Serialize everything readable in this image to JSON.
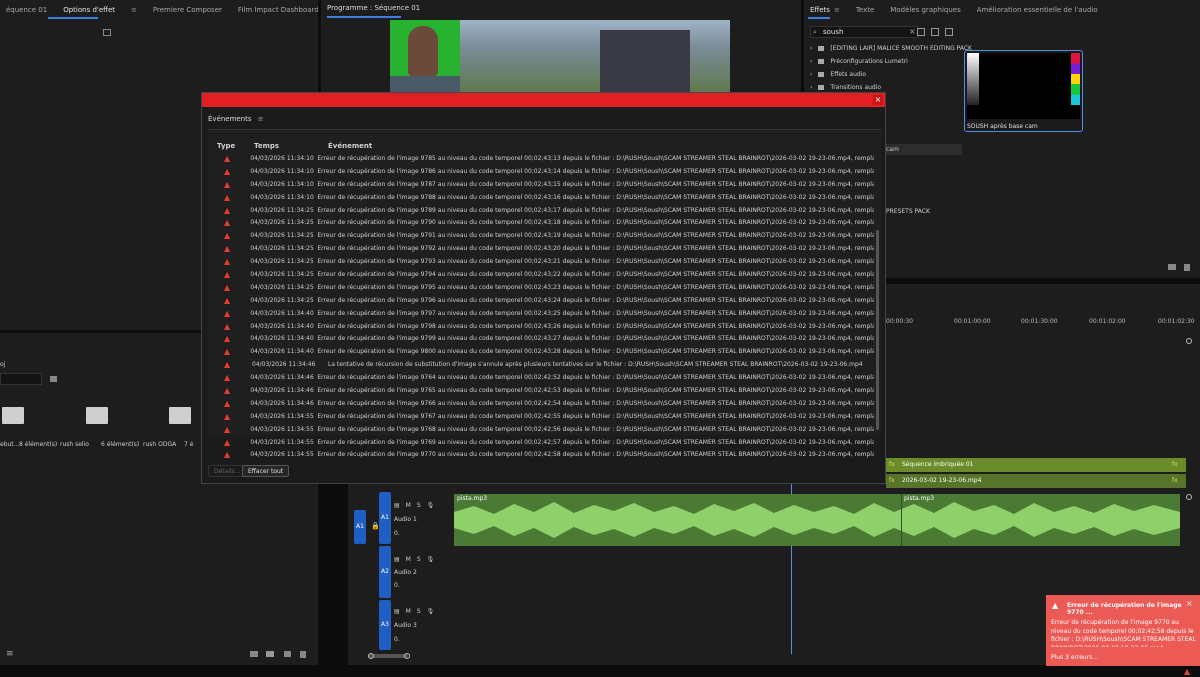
{
  "left_panel": {
    "tabs": [
      {
        "label": "équence 01"
      },
      {
        "label": "Options d'effet"
      },
      {
        "label": "Premiere Composer"
      },
      {
        "label": "Film Impact Dashboard"
      }
    ],
    "project_label": "oj",
    "bins": [
      {
        "name": "ebut...",
        "count": "8 élément(s)"
      },
      {
        "name": "rush selio",
        "count": "6 élément(s)"
      },
      {
        "name": "rush ODGA",
        "count": "7 é"
      }
    ]
  },
  "program_monitor": {
    "title": "Programme : Séquence 01"
  },
  "effects_panel": {
    "tabs": [
      {
        "label": "Effets"
      },
      {
        "label": "Texte"
      },
      {
        "label": "Modèles graphiques"
      },
      {
        "label": "Amélioration essentielle de l'audio"
      }
    ],
    "search_value": "soush",
    "tree": [
      {
        "label": "[EDITING LAIR] MALICE SMOOTH EDITING PACK"
      },
      {
        "label": "Préconfigurations Lumetri"
      },
      {
        "label": "Effets audio"
      },
      {
        "label": "Transitions audio"
      }
    ],
    "partial_labels": [
      "cam",
      "PRESETS PACK"
    ],
    "preview_caption": "SOUSH après base cam"
  },
  "events_dialog": {
    "title": "Événements",
    "columns": {
      "type": "Type",
      "time": "Temps",
      "event": "Événement"
    },
    "rows": [
      {
        "time": "04/03/2026 11:34:10",
        "msg": "Erreur de récupération de l'image 9785 au niveau du code temporel 00;02;43;13 depuis le fichier : D:\\RUSH\\Soush\\SCAM STREAMER STEAL BRAINROT\\2026-03-02 19-23-06.mp4, remplacement de l'image 9784"
      },
      {
        "time": "04/03/2026 11:34:10",
        "msg": "Erreur de récupération de l'image 9786 au niveau du code temporel 00;02;43;14 depuis le fichier : D:\\RUSH\\Soush\\SCAM STREAMER STEAL BRAINROT\\2026-03-02 19-23-06.mp4, remplacement de l'image 9785"
      },
      {
        "time": "04/03/2026 11:34:10",
        "msg": "Erreur de récupération de l'image 9787 au niveau du code temporel 00;02;43;15 depuis le fichier : D:\\RUSH\\Soush\\SCAM STREAMER STEAL BRAINROT\\2026-03-02 19-23-06.mp4, remplacement de l'image 9786"
      },
      {
        "time": "04/03/2026 11:34:10",
        "msg": "Erreur de récupération de l'image 9788 au niveau du code temporel 00;02;43;16 depuis le fichier : D:\\RUSH\\Soush\\SCAM STREAMER STEAL BRAINROT\\2026-03-02 19-23-06.mp4, remplacement de l'image 9787"
      },
      {
        "time": "04/03/2026 11:34:25",
        "msg": "Erreur de récupération de l'image 9789 au niveau du code temporel 00;02;43;17 depuis le fichier : D:\\RUSH\\Soush\\SCAM STREAMER STEAL BRAINROT\\2026-03-02 19-23-06.mp4, remplacement de l'image 9788"
      },
      {
        "time": "04/03/2026 11:34:25",
        "msg": "Erreur de récupération de l'image 9790 au niveau du code temporel 00;02;43;18 depuis le fichier : D:\\RUSH\\Soush\\SCAM STREAMER STEAL BRAINROT\\2026-03-02 19-23-06.mp4, remplacement de l'image 9789"
      },
      {
        "time": "04/03/2026 11:34:25",
        "msg": "Erreur de récupération de l'image 9791 au niveau du code temporel 00;02;43;19 depuis le fichier : D:\\RUSH\\Soush\\SCAM STREAMER STEAL BRAINROT\\2026-03-02 19-23-06.mp4, remplacement de l'image 9790"
      },
      {
        "time": "04/03/2026 11:34:25",
        "msg": "Erreur de récupération de l'image 9792 au niveau du code temporel 00;02;43;20 depuis le fichier : D:\\RUSH\\Soush\\SCAM STREAMER STEAL BRAINROT\\2026-03-02 19-23-06.mp4, remplacement de l'image 9791"
      },
      {
        "time": "04/03/2026 11:34:25",
        "msg": "Erreur de récupération de l'image 9793 au niveau du code temporel 00;02;43;21 depuis le fichier : D:\\RUSH\\Soush\\SCAM STREAMER STEAL BRAINROT\\2026-03-02 19-23-06.mp4, remplacement de l'image 9792"
      },
      {
        "time": "04/03/2026 11:34:25",
        "msg": "Erreur de récupération de l'image 9794 au niveau du code temporel 00;02;43;22 depuis le fichier : D:\\RUSH\\Soush\\SCAM STREAMER STEAL BRAINROT\\2026-03-02 19-23-06.mp4, remplacement de l'image 9793"
      },
      {
        "time": "04/03/2026 11:34:25",
        "msg": "Erreur de récupération de l'image 9795 au niveau du code temporel 00;02;43;23 depuis le fichier : D:\\RUSH\\Soush\\SCAM STREAMER STEAL BRAINROT\\2026-03-02 19-23-06.mp4, remplacement de l'image 9794"
      },
      {
        "time": "04/03/2026 11:34:25",
        "msg": "Erreur de récupération de l'image 9796 au niveau du code temporel 00;02;43;24 depuis le fichier : D:\\RUSH\\Soush\\SCAM STREAMER STEAL BRAINROT\\2026-03-02 19-23-06.mp4, remplacement de l'image 9795"
      },
      {
        "time": "04/03/2026 11:34:40",
        "msg": "Erreur de récupération de l'image 9797 au niveau du code temporel 00;02;43;25 depuis le fichier : D:\\RUSH\\Soush\\SCAM STREAMER STEAL BRAINROT\\2026-03-02 19-23-06.mp4, remplacement de l'image 9796"
      },
      {
        "time": "04/03/2026 11:34:40",
        "msg": "Erreur de récupération de l'image 9798 au niveau du code temporel 00;02;43;26 depuis le fichier : D:\\RUSH\\Soush\\SCAM STREAMER STEAL BRAINROT\\2026-03-02 19-23-06.mp4, remplacement de l'image 9797"
      },
      {
        "time": "04/03/2026 11:34:40",
        "msg": "Erreur de récupération de l'image 9799 au niveau du code temporel 00;02;43;27 depuis le fichier : D:\\RUSH\\Soush\\SCAM STREAMER STEAL BRAINROT\\2026-03-02 19-23-06.mp4, remplacement de l'image 9798"
      },
      {
        "time": "04/03/2026 11:34:40",
        "msg": "Erreur de récupération de l'image 9800 au niveau du code temporel 00;02;43;28 depuis le fichier : D:\\RUSH\\Soush\\SCAM STREAMER STEAL BRAINROT\\2026-03-02 19-23-06.mp4, remplacement de l'image 9799"
      },
      {
        "time": "04/03/2026 11:34:46",
        "msg": "La tentative de récursion de substitution d'image s'annule après plusieurs tentatives sur le fichier : D:\\RUSH\\Soush\\SCAM STREAMER STEAL BRAINROT\\2026-03-02 19-23-06.mp4"
      },
      {
        "time": "04/03/2026 11:34:46",
        "msg": "Erreur de récupération de l'image 9764 au niveau du code temporel 00;02;42;52 depuis le fichier : D:\\RUSH\\Soush\\SCAM STREAMER STEAL BRAINROT\\2026-03-02 19-23-06.mp4, remplacement de l'image 9763"
      },
      {
        "time": "04/03/2026 11:34:46",
        "msg": "Erreur de récupération de l'image 9765 au niveau du code temporel 00;02;42;53 depuis le fichier : D:\\RUSH\\Soush\\SCAM STREAMER STEAL BRAINROT\\2026-03-02 19-23-06.mp4, remplacement de l'image 9764"
      },
      {
        "time": "04/03/2026 11:34:46",
        "msg": "Erreur de récupération de l'image 9766 au niveau du code temporel 00;02;42;54 depuis le fichier : D:\\RUSH\\Soush\\SCAM STREAMER STEAL BRAINROT\\2026-03-02 19-23-06.mp4, remplacement de l'image 9765"
      },
      {
        "time": "04/03/2026 11:34:55",
        "msg": "Erreur de récupération de l'image 9767 au niveau du code temporel 00;02;42;55 depuis le fichier : D:\\RUSH\\Soush\\SCAM STREAMER STEAL BRAINROT\\2026-03-02 19-23-06.mp4, remplacement de l'image 9766"
      },
      {
        "time": "04/03/2026 11:34:55",
        "msg": "Erreur de récupération de l'image 9768 au niveau du code temporel 00;02;42;56 depuis le fichier : D:\\RUSH\\Soush\\SCAM STREAMER STEAL BRAINROT\\2026-03-02 19-23-06.mp4, remplacement de l'image 9767"
      },
      {
        "time": "04/03/2026 11:34:55",
        "msg": "Erreur de récupération de l'image 9769 au niveau du code temporel 00;02;42;57 depuis le fichier : D:\\RUSH\\Soush\\SCAM STREAMER STEAL BRAINROT\\2026-03-02 19-23-06.mp4, remplacement de l'image 9768"
      },
      {
        "time": "04/03/2026 11:34:55",
        "msg": "Erreur de récupération de l'image 9770 au niveau du code temporel 00;02;42;58 depuis le fichier : D:\\RUSH\\Soush\\SCAM STREAMER STEAL BRAINROT\\2026-03-02 19-23-06.mp4, remplacement de l'image 9769"
      }
    ],
    "details_label": "Détails...",
    "clear_label": "Effacer tout"
  },
  "timeline": {
    "timecodes": [
      "00:00:30",
      "00:01:00:00",
      "00:01:30:00",
      "00:01:30",
      "00:01:02:00",
      "00:01:02:30"
    ],
    "video_clips": [
      {
        "label": "Séquence imbriquée 01"
      },
      {
        "label": "2026-03-02 19-23-06.mp4"
      }
    ],
    "audio_tracks": [
      {
        "id": "A1",
        "name": "Audio 1"
      },
      {
        "id": "A2",
        "name": "Audio 2"
      },
      {
        "id": "A3",
        "name": "Audio 3"
      }
    ],
    "audio_clip_labels": [
      "pista.mp3",
      "pista.mp3"
    ],
    "track_source_label": "A1",
    "mute_label": "M",
    "solo_label": "S",
    "fx_label": "fx",
    "volume_value": "0."
  },
  "toast": {
    "title": "Erreur de récupération de l'image 9770 ...",
    "body": "Erreur de récupération de l'image 9770 au niveau du code temporel 00;02;42;58 depuis le fichier : D:\\RUSH\\Soush\\SCAM STREAMER STEAL BRAINROT\\2026-03-02 19-23-06.mp4, remplacement de l'image 9769",
    "more": "Plus 3 erreurs..."
  },
  "colors": {
    "accent_red": "#e31e24",
    "audio_green": "#4b7a35",
    "track_blue": "#1f5fc4",
    "toast_red": "#ec5a55"
  }
}
